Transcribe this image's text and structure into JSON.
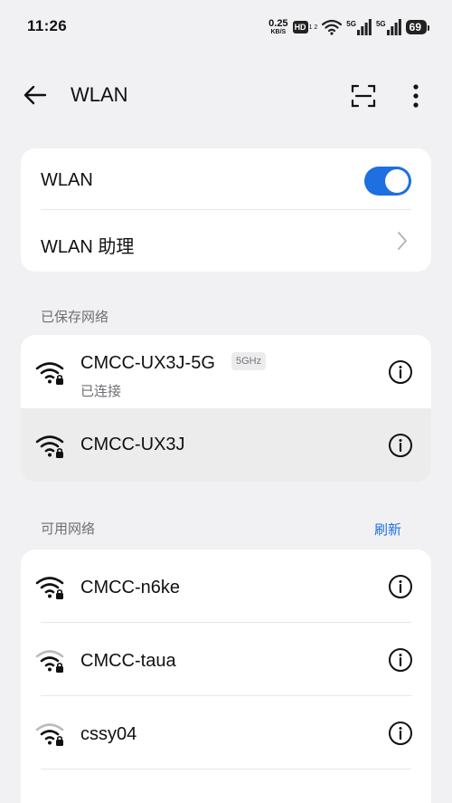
{
  "status_bar": {
    "time": "11:26",
    "net_speed_value": "0.25",
    "net_speed_unit": "KB/S",
    "hd_label": "HD",
    "hd_sub": "1 2",
    "sim1_label": "5G",
    "sim2_label": "5G",
    "battery": "69"
  },
  "header": {
    "title": "WLAN",
    "icons": [
      "back-arrow-icon",
      "scan-icon",
      "more-vert-icon"
    ]
  },
  "wlan_card": {
    "toggle_label": "WLAN",
    "toggle_on": true,
    "assistant_label": "WLAN 助理"
  },
  "saved_networks": {
    "section_label": "已保存网络",
    "items": [
      {
        "ssid": "CMCC-UX3J-5G",
        "band": "5GHz",
        "status": "已连接"
      },
      {
        "ssid": "CMCC-UX3J"
      }
    ]
  },
  "available_networks": {
    "section_label": "可用网络",
    "refresh_label": "刷新",
    "items": [
      {
        "ssid": "CMCC-n6ke"
      },
      {
        "ssid": "CMCC-taua"
      },
      {
        "ssid": "cssy04"
      }
    ]
  },
  "colors": {
    "accent": "#1e6fe0",
    "background": "#f1f1f3",
    "card": "#ffffff"
  }
}
